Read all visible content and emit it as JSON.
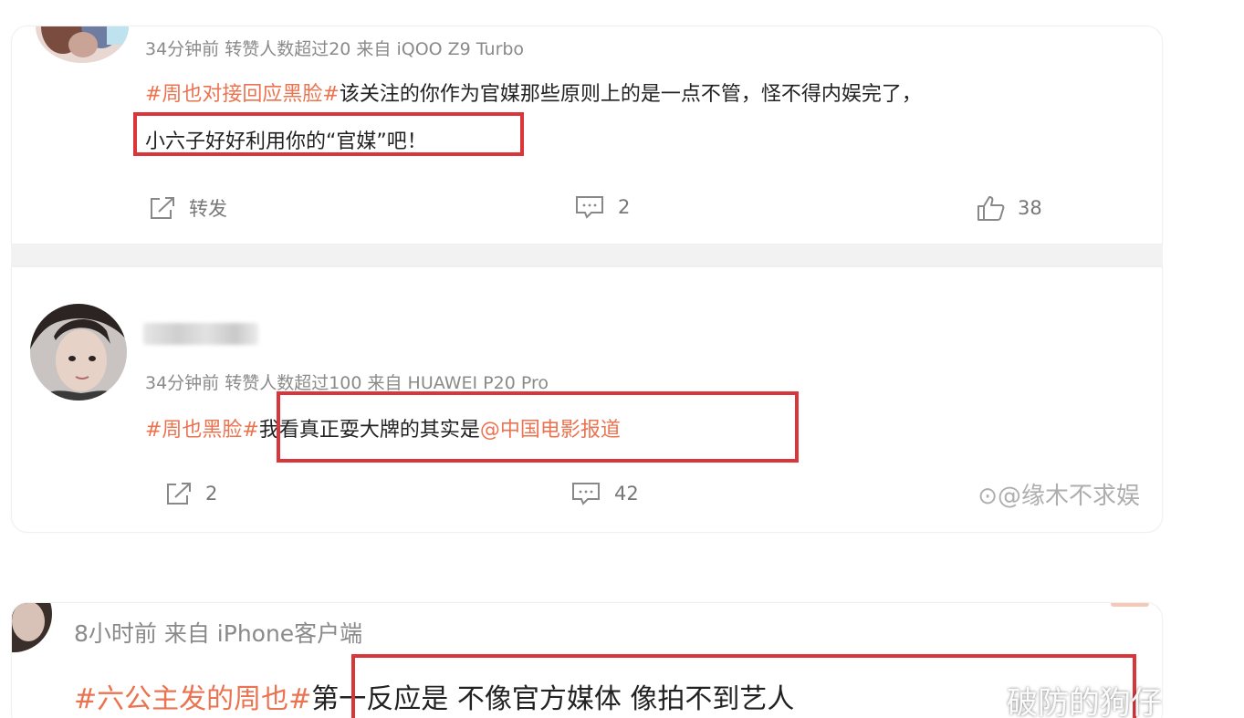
{
  "post1": {
    "meta": "34分钟前 转赞人数超过20 来自 iQOO Z9 Turbo",
    "hashtag": "#周也对接回应黑脸#",
    "text_line1": "该关注的你作为官媒那些原则上的是一点不管，怪不得内娱完了，",
    "text_line2": "小六子好好利用你的“官媒”吧！",
    "repost_label": "转发",
    "comment_count": "2",
    "like_count": "38"
  },
  "post2": {
    "meta": "34分钟前 转赞人数超过100 来自 HUAWEI P20 Pro",
    "hashtag": "#周也黑脸#",
    "text": "我看真正耍大牌的其实是",
    "mention": "@中国电影报道",
    "repost_count": "2",
    "comment_count": "42",
    "watermark": "⊙@缘木不求娱"
  },
  "post3": {
    "meta": "8小时前 来自 iPhone客户端",
    "hashtag": "#六公主发的周也#",
    "text": "第一反应是 不像官方媒体 像拍不到艺人",
    "watermark": "破防的狗仔 "
  },
  "colors": {
    "highlight_box": "#d9363b",
    "hashtag": "#eb7350",
    "meta_gray": "#8a8a8a"
  },
  "icons": [
    "repost-icon",
    "comment-icon",
    "like-icon"
  ]
}
